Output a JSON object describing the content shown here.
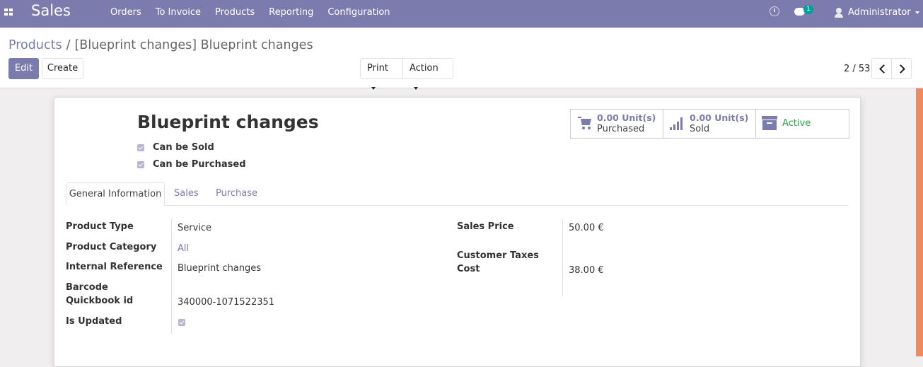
{
  "topbar": {
    "app_name": "Sales",
    "menu": [
      "Orders",
      "To Invoice",
      "Products",
      "Reporting",
      "Configuration"
    ],
    "chat_badge": "1",
    "user_name": "Administrator",
    "accent_color": "#7c7bad"
  },
  "breadcrumb": {
    "parent": "Products",
    "separator": "/",
    "current": "[Blueprint changes] Blueprint changes"
  },
  "buttons": {
    "edit": "Edit",
    "create": "Create",
    "print": "Print",
    "action": "Action"
  },
  "pager": {
    "value": "2 / 53"
  },
  "product": {
    "name": "Blueprint changes",
    "can_be_sold_label": "Can be Sold",
    "can_be_purchased_label": "Can be Purchased"
  },
  "smart_buttons": {
    "purchased_value": "0.00 Unit(s)",
    "purchased_label": "Purchased",
    "sold_value": "0.00 Unit(s)",
    "sold_label": "Sold",
    "active_label": "Active"
  },
  "tabs": [
    "General Information",
    "Sales",
    "Purchase"
  ],
  "fields_left": {
    "product_type_label": "Product Type",
    "product_type_value": "Service",
    "category_label": "Product Category",
    "category_value": "All",
    "internal_ref_label": "Internal Reference",
    "internal_ref_value": "Blueprint changes",
    "barcode_label": "Barcode",
    "quickbook_label": "Quickbook id",
    "quickbook_value": "340000-1071522351",
    "is_updated_label": "Is Updated"
  },
  "fields_right": {
    "sales_price_label": "Sales Price",
    "sales_price_value": "50.00 €",
    "customer_taxes_label": "Customer Taxes",
    "cost_label": "Cost",
    "cost_value": "38.00 €"
  }
}
